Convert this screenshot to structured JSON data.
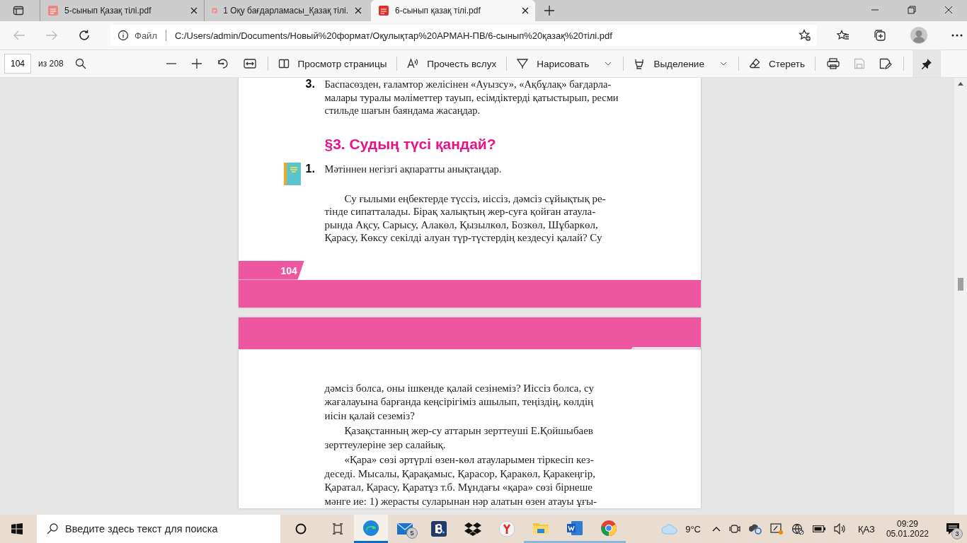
{
  "tabs": [
    {
      "title": "5-сынып Қазақ тілі.pdf",
      "selected": false
    },
    {
      "title": "1 Оқу бағдарламасы_Қазақ тілі.",
      "selected": false
    },
    {
      "title": "6-сынып қазақ тілі.pdf",
      "selected": true
    }
  ],
  "address": {
    "scheme": "Файл",
    "url": "C:/Users/admin/Documents/Новый%20формат/Оқулықтар%20АРМАН-ПВ/6-сынып%20қазақ%20тілі.pdf"
  },
  "pdf_toolbar": {
    "page": "104",
    "total": "из 208",
    "tools": [
      {
        "kind": "view",
        "label": "Просмотр страницы",
        "dropdown": false
      },
      {
        "kind": "read",
        "label": "Прочесть вслух",
        "dropdown": false
      },
      {
        "kind": "draw",
        "label": "Нарисовать",
        "dropdown": true
      },
      {
        "kind": "highlight",
        "label": "Выделение",
        "dropdown": true
      },
      {
        "kind": "erase",
        "label": "Стереть",
        "dropdown": false
      }
    ],
    "save_disabled": true,
    "pinned": true
  },
  "pages": [
    {
      "blocks": [
        {
          "kind": "task",
          "number": "3.",
          "icon": false,
          "text": "Баспасөзден, ғаламтор желісінен «Ауызсу», «Ақбұлақ» бағдарла-\nмалары туралы мәліметтер тауып, есімдіктерді қатыстырып, ресми\nстильде шағын баяндама жасаңдар."
        },
        {
          "kind": "heading",
          "text": "§3. Судың түсі қандай?"
        },
        {
          "kind": "task",
          "number": "1.",
          "icon": true,
          "text": "Мәтіннен негізгі ақпаратты анықтаңдар."
        },
        {
          "kind": "para",
          "text": "Су ғылыми еңбектерде түссіз, иіссіз, дәмсіз сұйықтық ре-\nтінде сипатталады. Бірақ халықтың жер-суға қойған атаула-\nрында Ақсу, Сарысу, Алакөл, Қызылкөл, Бозкөл, Шұбаркөл,\nҚарасу, Көксу секілді алуан түр-түстердің кездесуі қалай? Су"
        }
      ],
      "footer_number": "104"
    },
    {
      "header_band": true,
      "blocks": [
        {
          "kind": "plain",
          "text": "дәмсіз болса, оны ішкенде қалай сезінеміз? Иіссіз болса, су\nжағалауына барғанда кеңсірігіміз ашылып, теңіздің, көлдің\nиісін қалай сеземіз?"
        },
        {
          "kind": "para",
          "text": "Қазақстанның жер-су аттарын зерттеуші Е.Қойшыбаев\nзерттеулеріне зер салайық."
        },
        {
          "kind": "para",
          "text": "«Қара» сөзі әртүрлі өзен-көл атауларымен тіркесіп кез-\nдеседі. Мысалы, Қарақамыс, Қарасор, Қаракөл, Қаракеңгір,\nҚаратал, Қарасу, Қаратұз т.б. Мұндағы «қара» сөзі бірнеше\nмәнге ие: 1) жерасты суларынан нәр алатын өзен атауы ұғы-"
        }
      ]
    }
  ],
  "taskbar": {
    "search_placeholder": "Введите здесь текст для поиска",
    "apps": [
      {
        "kind": "edge",
        "running": true,
        "active": true
      },
      {
        "kind": "mail",
        "running": false,
        "active": false,
        "badge": "5"
      },
      {
        "kind": "b",
        "running": false,
        "active": false
      },
      {
        "kind": "dropbox",
        "running": false,
        "active": false
      },
      {
        "kind": "yandex",
        "running": false,
        "active": false
      },
      {
        "kind": "explorer",
        "running": true,
        "active": false
      },
      {
        "kind": "word",
        "running": true,
        "active": false
      },
      {
        "kind": "chrome",
        "running": true,
        "active": false
      }
    ],
    "weather": "9°C",
    "language": "ҚАЗ",
    "time": "09:29",
    "date": "05.01.2022",
    "notifications": "3"
  }
}
